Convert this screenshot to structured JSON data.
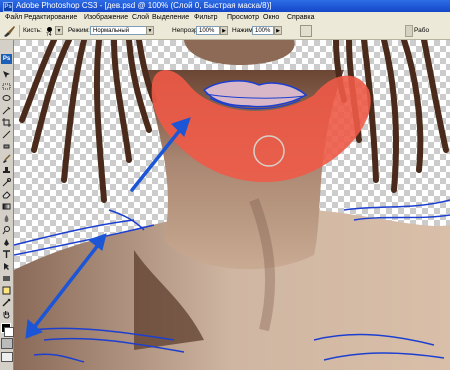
{
  "window": {
    "title": "Adobe Photoshop CS3 - [дев.psd @ 100% (Слой 0, Быстрая маска/8)]",
    "app_icon": "Ps"
  },
  "menu": [
    "Файл",
    "Редактирование",
    "Изображение",
    "Слой",
    "Выделение",
    "Фильтр",
    "Просмотр",
    "Окно",
    "Справка"
  ],
  "options": {
    "brush_label": "Кисть:",
    "brush_size": "74",
    "mode_label": "Режим:",
    "mode_value": "Нормальный",
    "opacity_label": "Непрозр.:",
    "opacity_value": "100%",
    "flow_label": "Нажим:",
    "flow_value": "100%",
    "panel_label": "Рабо"
  },
  "toolbox": {
    "logo": "Ps",
    "fg_color": "#000000",
    "bg_color": "#ffffff"
  },
  "canvas": {
    "quick_mask_color": "#ee5a47",
    "annotation_arrow_color": "#1c55d6",
    "skin_color": "#b8927a",
    "hair_color": "#4a2a1a"
  }
}
